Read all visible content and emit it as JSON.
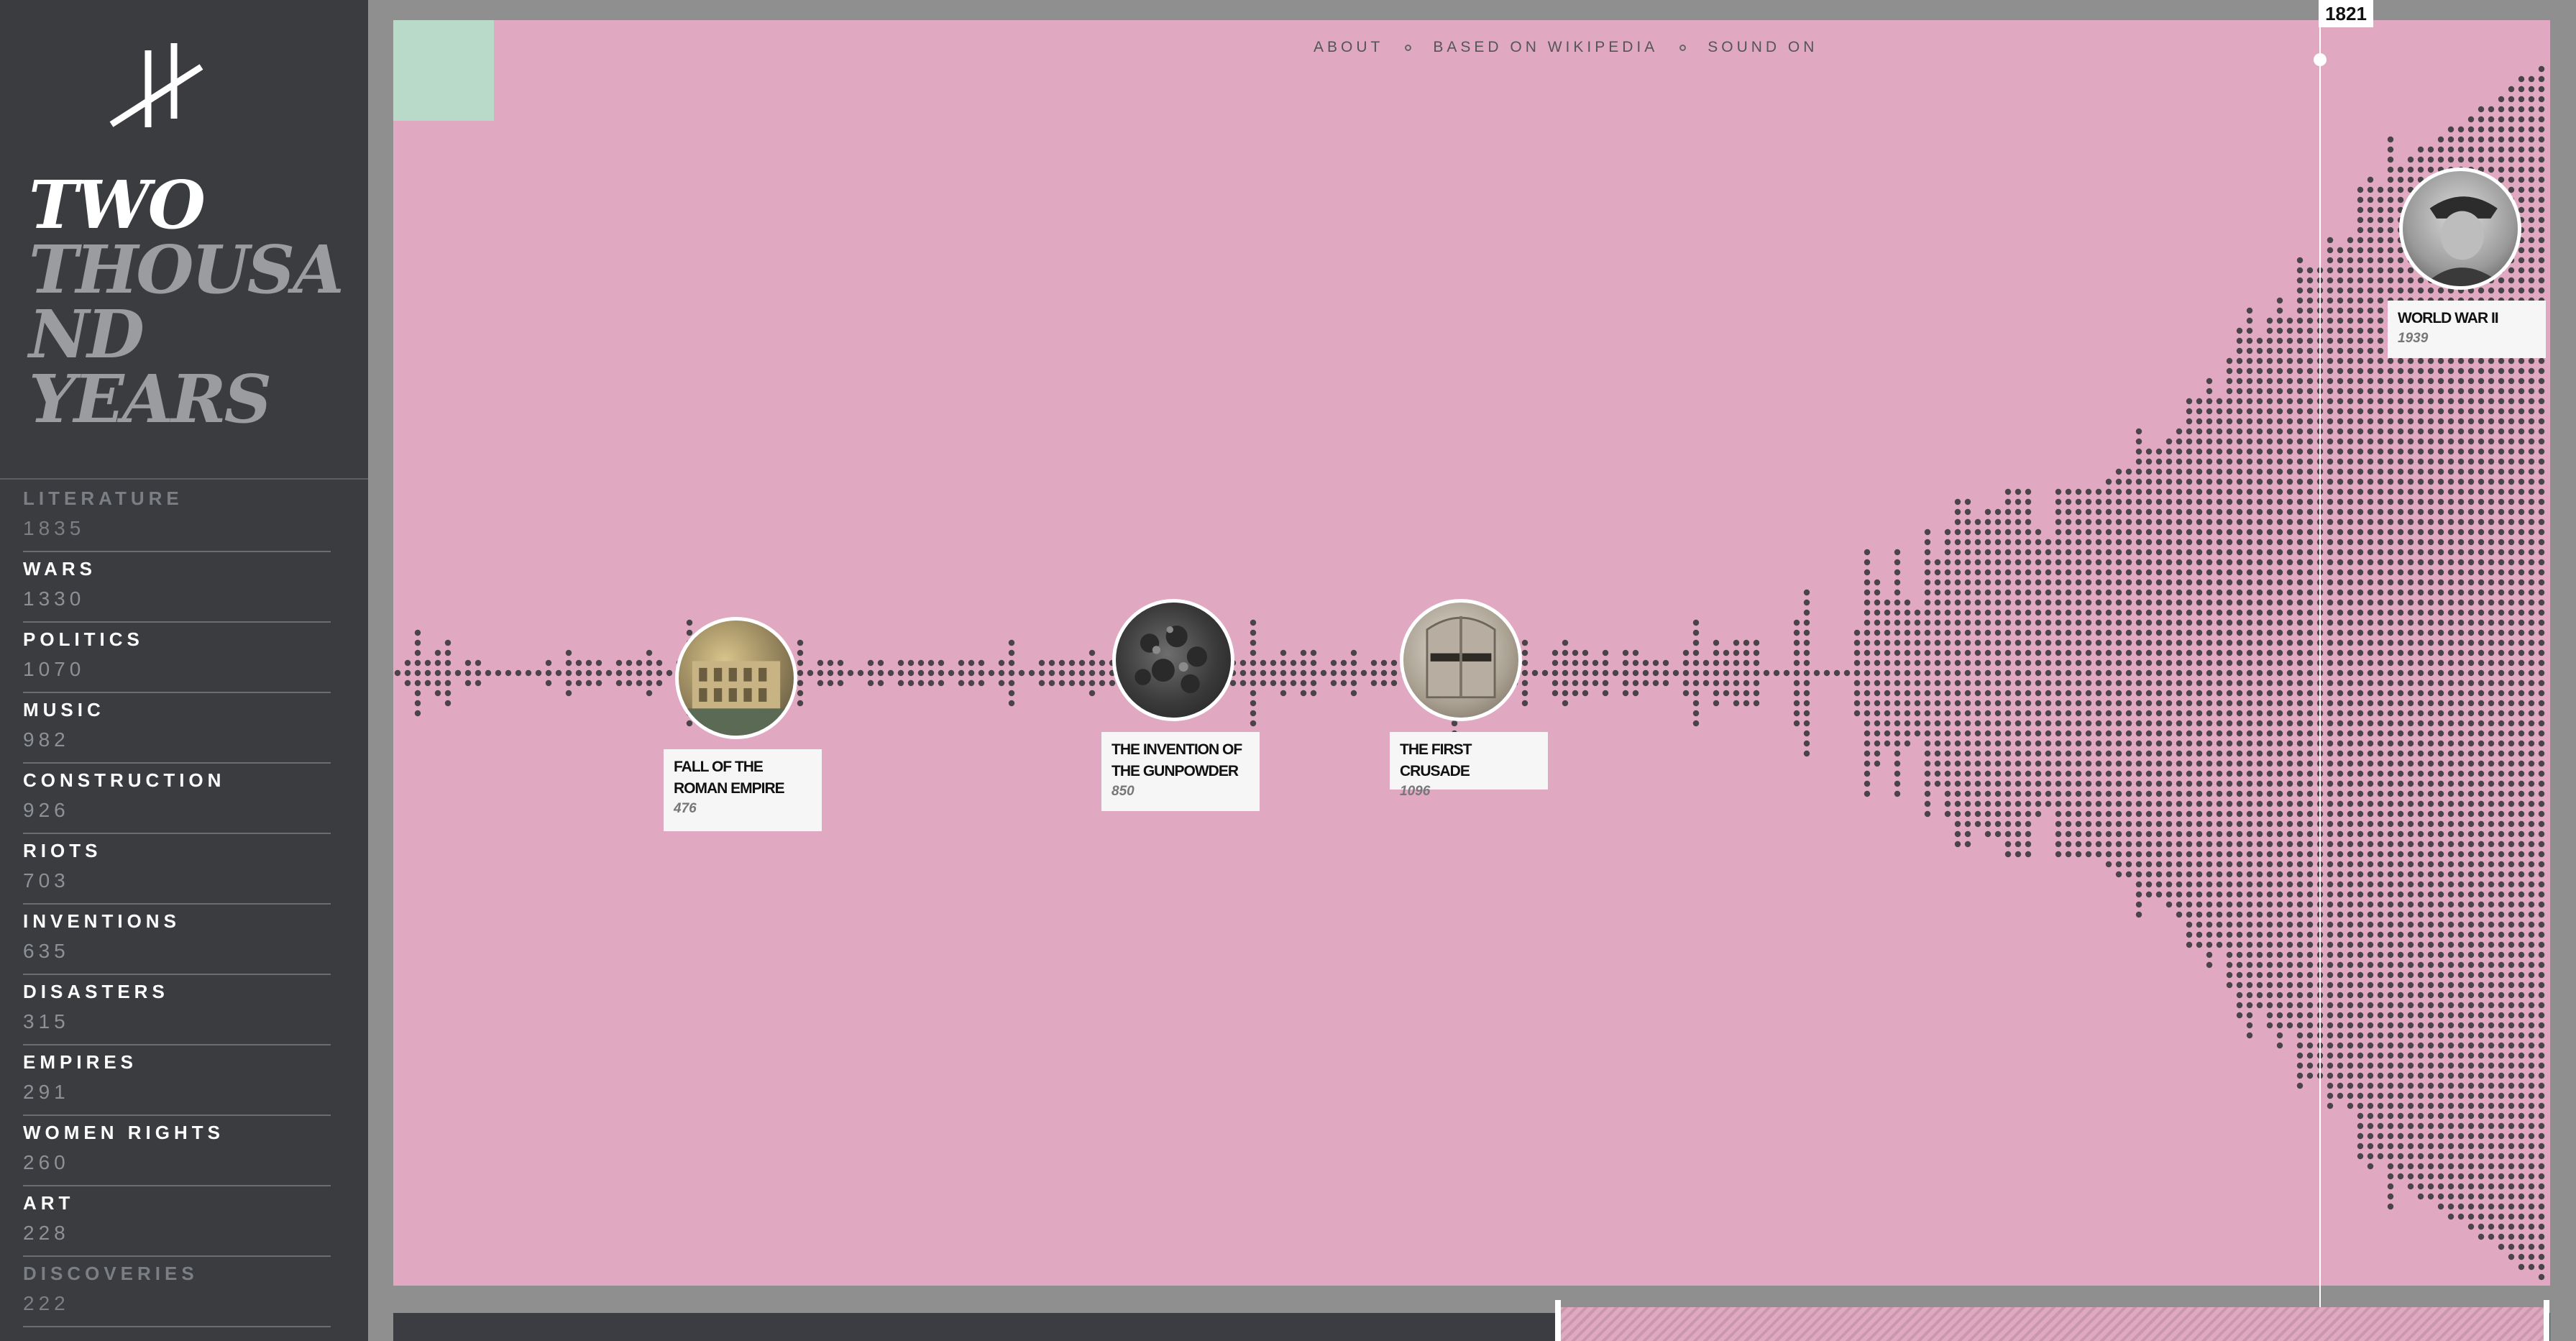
{
  "sidebar": {
    "title_line1": "TWO",
    "title_line2": "THOUSA",
    "title_line3": "ND",
    "title_line4": "YEARS",
    "categories": [
      {
        "name": "LITERATURE",
        "count": "1835"
      },
      {
        "name": "WARS",
        "count": "1330"
      },
      {
        "name": "POLITICS",
        "count": "1070"
      },
      {
        "name": "MUSIC",
        "count": "982"
      },
      {
        "name": "CONSTRUCTION",
        "count": "926"
      },
      {
        "name": "RIOTS",
        "count": "703"
      },
      {
        "name": "INVENTIONS",
        "count": "635"
      },
      {
        "name": "DISASTERS",
        "count": "315"
      },
      {
        "name": "EMPIRES",
        "count": "291"
      },
      {
        "name": "WOMEN RIGHTS",
        "count": "260"
      },
      {
        "name": "ART",
        "count": "228"
      },
      {
        "name": "DISCOVERIES",
        "count": "222"
      }
    ]
  },
  "nav": {
    "about": "ABOUT",
    "source": "BASED ON WIKIPEDIA",
    "sound": "SOUND ON"
  },
  "timeline": {
    "current_year": "1821"
  },
  "events": [
    {
      "name_line1": "FALL OF THE",
      "name_line2": "ROMAN EMPIRE",
      "year": "476",
      "photo_icon": "colosseum-icon"
    },
    {
      "name_line1": "THE INVENTION OF",
      "name_line2": "THE GUNPOWDER",
      "year": "850",
      "photo_icon": "gunpowder-icon"
    },
    {
      "name_line1": "THE FIRST CRUSADE",
      "name_line2": "",
      "year": "1096",
      "photo_icon": "helmet-icon"
    },
    {
      "name_line1": "WORLD WAR II",
      "name_line2": "",
      "year": "1939",
      "photo_icon": "portrait-icon"
    }
  ],
  "colors": {
    "background": "#e0a9c1",
    "sidebar": "#3a3c40",
    "dots": "#4a4448",
    "accent_square": "#b9d9c9"
  }
}
